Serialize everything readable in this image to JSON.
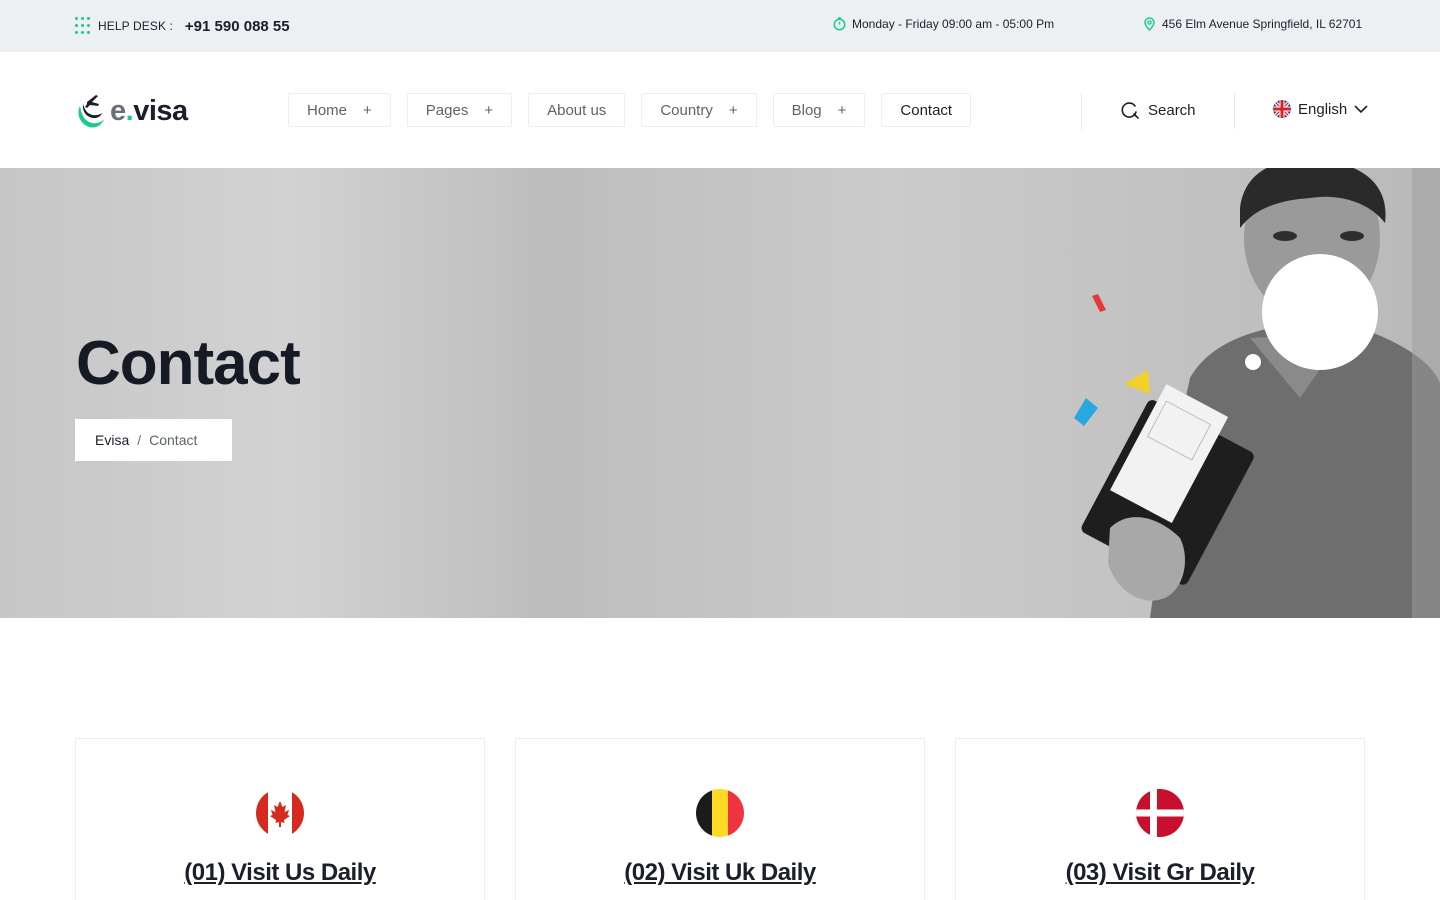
{
  "topbar": {
    "helpdesk_label": "HELP DESK :",
    "helpdesk_phone": "+91 590 088 55",
    "hours": "Monday - Friday 09:00 am - 05:00 Pm",
    "address": "456 Elm Avenue Springfield, IL 62701"
  },
  "header": {
    "logo_e": "e",
    "logo_dot": ".",
    "logo_visa": "visa",
    "nav": [
      {
        "label": "Home",
        "plus": "+"
      },
      {
        "label": "Pages",
        "plus": "+"
      },
      {
        "label": "About us"
      },
      {
        "label": "Country",
        "plus": "+"
      },
      {
        "label": "Blog",
        "plus": "+"
      },
      {
        "label": "Contact"
      }
    ],
    "search_label": "Search",
    "language": "English"
  },
  "hero": {
    "title": "Contact",
    "breadcrumb": {
      "home": "Evisa",
      "separator": "/",
      "current": "Contact"
    }
  },
  "cards": [
    {
      "title": "(01) Visit Us Daily",
      "flag": "canada-flag-icon"
    },
    {
      "title": "(02) Visit Uk Daily",
      "flag": "belgium-flag-icon"
    },
    {
      "title": "(03) Visit Gr Daily",
      "flag": "denmark-flag-icon"
    }
  ],
  "colors": {
    "accent": "#1ec88e",
    "dark": "#1b1f2a",
    "topbar_bg": "#edf0f3"
  }
}
